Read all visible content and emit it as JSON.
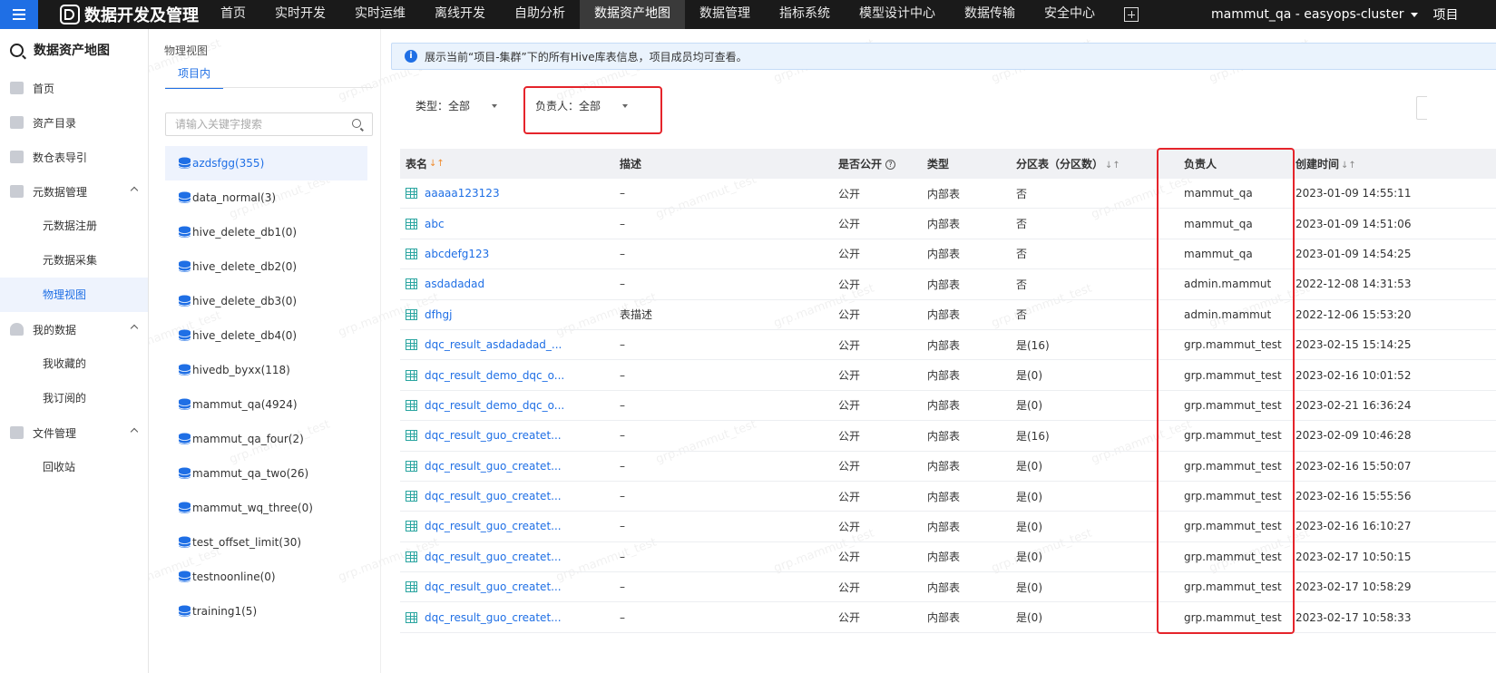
{
  "topnav": {
    "brand": "数据开发及管理",
    "items": [
      {
        "label": "首页",
        "active": false
      },
      {
        "label": "实时开发",
        "active": false
      },
      {
        "label": "实时运维",
        "active": false
      },
      {
        "label": "离线开发",
        "active": false
      },
      {
        "label": "自助分析",
        "active": false
      },
      {
        "label": "数据资产地图",
        "active": true
      },
      {
        "label": "数据管理",
        "active": false
      },
      {
        "label": "指标系统",
        "active": false
      },
      {
        "label": "模型设计中心",
        "active": false
      },
      {
        "label": "数据传输",
        "active": false
      },
      {
        "label": "安全中心",
        "active": false
      }
    ],
    "user": "mammut_qa - easyops-cluster",
    "more": "项目"
  },
  "sidebar": {
    "title": "数据资产地图",
    "items": [
      {
        "label": "首页"
      },
      {
        "label": "资产目录"
      },
      {
        "label": "数仓表导引"
      },
      {
        "label": "元数据管理"
      },
      {
        "label": "元数据注册"
      },
      {
        "label": "元数据采集"
      },
      {
        "label": "物理视图"
      },
      {
        "label": "我的数据"
      },
      {
        "label": "我收藏的"
      },
      {
        "label": "我订阅的"
      },
      {
        "label": "文件管理"
      },
      {
        "label": "回收站"
      }
    ]
  },
  "tree": {
    "breadcrumb": "物理视图",
    "tab": "项目内",
    "search_placeholder": "请输入关键字搜索",
    "databases": [
      "azdsfgg(355)",
      "data_normal(3)",
      "hive_delete_db1(0)",
      "hive_delete_db2(0)",
      "hive_delete_db3(0)",
      "hive_delete_db4(0)",
      "hivedb_byxx(118)",
      "mammut_qa(4924)",
      "mammut_qa_four(2)",
      "mammut_qa_two(26)",
      "mammut_wq_three(0)",
      "test_offset_limit(30)",
      "testnoonline(0)",
      "training1(5)"
    ]
  },
  "main": {
    "info": "展示当前“项目-集群”下的所有Hive库表信息，项目成员均可查看。",
    "filters": {
      "type_label": "类型：",
      "type_value": "全部",
      "owner_label": "负责人：",
      "owner_value": "全部"
    },
    "columns": {
      "name": "表名",
      "desc": "描述",
      "public": "是否公开",
      "type": "类型",
      "partition": "分区表（分区数）",
      "owner": "负责人",
      "ctime": "创建时间"
    },
    "rows": [
      {
        "name": "aaaaa123123",
        "desc": "–",
        "public": "公开",
        "type": "内部表",
        "partition": "否",
        "owner": "mammut_qa",
        "ctime": "2023-01-09 14:55:11"
      },
      {
        "name": "abc",
        "desc": "–",
        "public": "公开",
        "type": "内部表",
        "partition": "否",
        "owner": "mammut_qa",
        "ctime": "2023-01-09 14:51:06"
      },
      {
        "name": "abcdefg123",
        "desc": "–",
        "public": "公开",
        "type": "内部表",
        "partition": "否",
        "owner": "mammut_qa",
        "ctime": "2023-01-09 14:54:25"
      },
      {
        "name": "asdadadad",
        "desc": "–",
        "public": "公开",
        "type": "内部表",
        "partition": "否",
        "owner": "admin.mammut",
        "ctime": "2022-12-08 14:31:53"
      },
      {
        "name": "dfhgj",
        "desc": "表描述",
        "public": "公开",
        "type": "内部表",
        "partition": "否",
        "owner": "admin.mammut",
        "ctime": "2022-12-06 15:53:20"
      },
      {
        "name": "dqc_result_asdadadad_...",
        "desc": "–",
        "public": "公开",
        "type": "内部表",
        "partition": "是(16)",
        "owner": "grp.mammut_test",
        "ctime": "2023-02-15 15:14:25"
      },
      {
        "name": "dqc_result_demo_dqc_o...",
        "desc": "–",
        "public": "公开",
        "type": "内部表",
        "partition": "是(0)",
        "owner": "grp.mammut_test",
        "ctime": "2023-02-16 10:01:52"
      },
      {
        "name": "dqc_result_demo_dqc_o...",
        "desc": "–",
        "public": "公开",
        "type": "内部表",
        "partition": "是(0)",
        "owner": "grp.mammut_test",
        "ctime": "2023-02-21 16:36:24"
      },
      {
        "name": "dqc_result_guo_createt...",
        "desc": "–",
        "public": "公开",
        "type": "内部表",
        "partition": "是(16)",
        "owner": "grp.mammut_test",
        "ctime": "2023-02-09 10:46:28"
      },
      {
        "name": "dqc_result_guo_createt...",
        "desc": "–",
        "public": "公开",
        "type": "内部表",
        "partition": "是(0)",
        "owner": "grp.mammut_test",
        "ctime": "2023-02-16 15:50:07"
      },
      {
        "name": "dqc_result_guo_createt...",
        "desc": "–",
        "public": "公开",
        "type": "内部表",
        "partition": "是(0)",
        "owner": "grp.mammut_test",
        "ctime": "2023-02-16 15:55:56"
      },
      {
        "name": "dqc_result_guo_createt...",
        "desc": "–",
        "public": "公开",
        "type": "内部表",
        "partition": "是(0)",
        "owner": "grp.mammut_test",
        "ctime": "2023-02-16 16:10:27"
      },
      {
        "name": "dqc_result_guo_createt...",
        "desc": "–",
        "public": "公开",
        "type": "内部表",
        "partition": "是(0)",
        "owner": "grp.mammut_test",
        "ctime": "2023-02-17 10:50:15"
      },
      {
        "name": "dqc_result_guo_createt...",
        "desc": "–",
        "public": "公开",
        "type": "内部表",
        "partition": "是(0)",
        "owner": "grp.mammut_test",
        "ctime": "2023-02-17 10:58:29"
      },
      {
        "name": "dqc_result_guo_createt...",
        "desc": "–",
        "public": "公开",
        "type": "内部表",
        "partition": "是(0)",
        "owner": "grp.mammut_test",
        "ctime": "2023-02-17 10:58:33"
      }
    ]
  },
  "watermark": "grp.mammut_test",
  "colors": {
    "accent": "#1f6fe5",
    "highlight": "#e5242b",
    "topbar": "#1a1a1a"
  }
}
